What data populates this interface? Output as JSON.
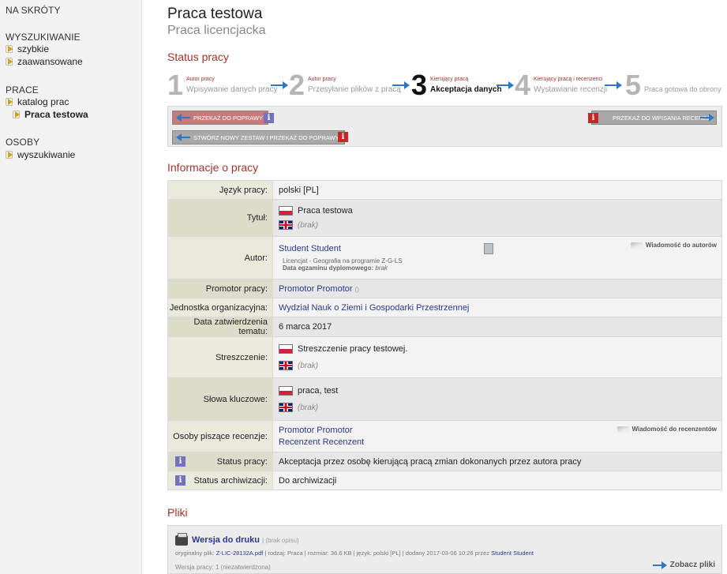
{
  "sidebar": {
    "shortcuts": "NA SKRÓTY",
    "search_header": "WYSZUKIWANIE",
    "search_items": [
      "szybkie",
      "zaawansowane"
    ],
    "works_header": "PRACE",
    "works_items": [
      "katalog prac",
      "Praca testowa"
    ],
    "people_header": "OSOBY",
    "people_items": [
      "wyszukiwanie"
    ]
  },
  "page": {
    "title": "Praca testowa",
    "subtitle": "Praca licencjacka"
  },
  "status": {
    "header": "Status pracy",
    "steps": [
      {
        "num": "1",
        "who": "Autor pracy",
        "label": "Wpisywanie danych pracy"
      },
      {
        "num": "2",
        "who": "Autor pracy",
        "label": "Przesyłanie plików z pracą"
      },
      {
        "num": "3",
        "who": "Kierujący pracą",
        "label": "Akceptacja danych"
      },
      {
        "num": "4",
        "who": "Kierujący pracą i recenzenci",
        "label": "Wystawianie recenzji"
      },
      {
        "num": "5",
        "who": "",
        "label": "Praca gotowa do obrony"
      }
    ],
    "btn_return": "PRZEKAŻ DO POPRAWY",
    "btn_new_set": "STWÓRZ NOWY ZESTAW I PRZEKAŻ DO POPRAWY",
    "btn_to_review": "PRZEKAŻ DO WPISANIA RECENZJI",
    "info_glyph": "i"
  },
  "info": {
    "header": "Informacje o pracy",
    "lang_label": "Język pracy:",
    "lang_value": "polski [PL]",
    "title_label": "Tytuł:",
    "title_pl": "Praca testowa",
    "title_en": "(brak)",
    "author_label": "Autor:",
    "author_name": "Student Student",
    "author_program": "Licencjat - Geografia na programie Z-G-LS",
    "exam_date_label": "Data egzaminu dyplomowego:",
    "exam_date_value": "brak",
    "msg_authors": "Wiadomość do autorów",
    "promoter_label": "Promotor pracy:",
    "promoter_value": "Promotor Promotor",
    "promoter_suffix": "()",
    "unit_label": "Jednostka organizacyjna:",
    "unit_value": "Wydział Nauk o Ziemi i Gospodarki Przestrzennej",
    "approval_label": "Data zatwierdzenia tematu:",
    "approval_value": "6 marca 2017",
    "abstract_label": "Streszczenie:",
    "abstract_pl": "Streszczenie pracy testowej.",
    "abstract_en": "(brak)",
    "keywords_label": "Słowa kluczowe:",
    "keywords_pl": "praca, test",
    "keywords_en": "(brak)",
    "reviewers_label": "Osoby piszące recenzje:",
    "reviewers": [
      "Promotor Promotor",
      "Recenzent Recenzent"
    ],
    "msg_reviewers": "Wiadomość do recenzentów",
    "work_status_label": "Status pracy:",
    "work_status_value": "Akceptacja przez osobę kierującą pracą zmian dokonanych przez autora pracy",
    "archive_label": "Status archiwizacji:",
    "archive_value": "Do archiwizacji"
  },
  "files": {
    "header": "Pliki",
    "file_title": "Wersja do druku",
    "file_desc": "| (brak opisu)",
    "orig_prefix": "oryginalny plik:",
    "orig_file": "Z-LIC-28132A.pdf",
    "details": "| rodzaj: Praca | rozmiar: 36.6 KB | język: polski [PL] | dodany 2017-03-06 10:26 przez",
    "added_by": "Student Student",
    "version": "Wersja pracy: 1 (niezatwierdzona)",
    "see_files": "Zobacz pliki"
  }
}
